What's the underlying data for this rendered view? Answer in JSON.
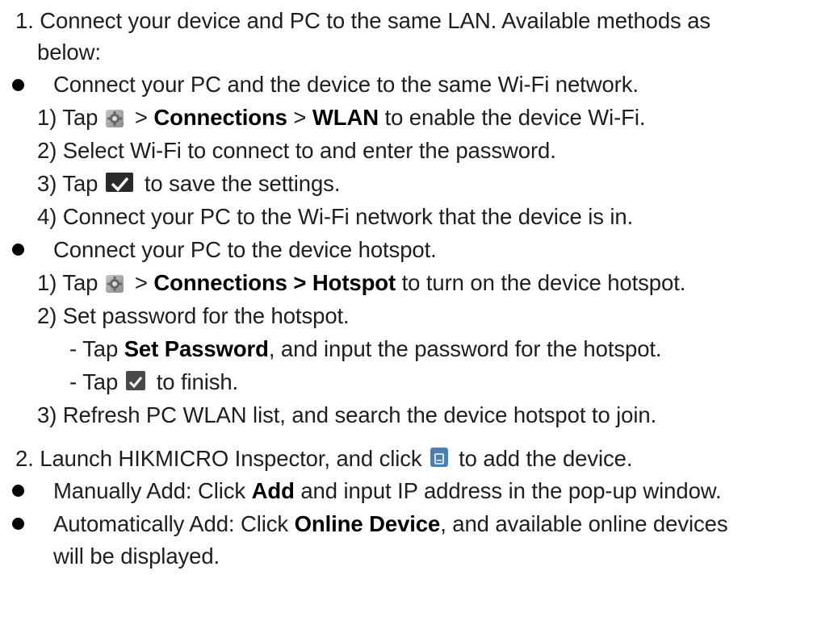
{
  "step1": {
    "line1": "1. Connect your device and PC to the same LAN. Available methods as",
    "line2": "below:"
  },
  "bullet_wifi": {
    "text": "Connect your PC and the device to the same Wi-Fi network.",
    "s1_pre": "1) Tap",
    "s1_gt1": ">",
    "s1_b1": "Connections",
    "s1_gt2": ">",
    "s1_b2": "WLAN",
    "s1_post": "to enable the device Wi-Fi.",
    "s2": "2) Select Wi-Fi to connect to and enter the password.",
    "s3_pre": "3) Tap",
    "s3_post": "to save the settings.",
    "s4": "4) Connect your PC to the Wi-Fi network that the device is in."
  },
  "bullet_hotspot": {
    "text": "Connect your PC to the device hotspot.",
    "s1_pre": "1) Tap",
    "s1_gt1": ">",
    "s1_b1": "Connections > Hotspot",
    "s1_post": "to turn on the device hotspot.",
    "s2": "2) Set password for the hotspot.",
    "sub1_pre": "- Tap",
    "sub1_b": "Set Password",
    "sub1_post": ", and input the password for the hotspot.",
    "sub2_pre": "- Tap",
    "sub2_post": "to finish.",
    "s3": "3) Refresh PC WLAN list, and search the device hotspot to join."
  },
  "step2": {
    "pre": "2. Launch HIKMICRO Inspector, and click",
    "post": "to add the device."
  },
  "bullet_manual": {
    "pre": "Manually Add: Click",
    "b": "Add",
    "post": "and input IP address in the pop-up window."
  },
  "bullet_auto": {
    "pre": "Automatically Add: Click",
    "b": "Online Device",
    "post": ", and available online devices",
    "line2": "will be displayed."
  },
  "icons": {
    "settings": "settings-gear-icon",
    "save": "checkmark-save-icon",
    "finish": "checkmark-finish-icon",
    "add_device": "add-device-icon"
  }
}
